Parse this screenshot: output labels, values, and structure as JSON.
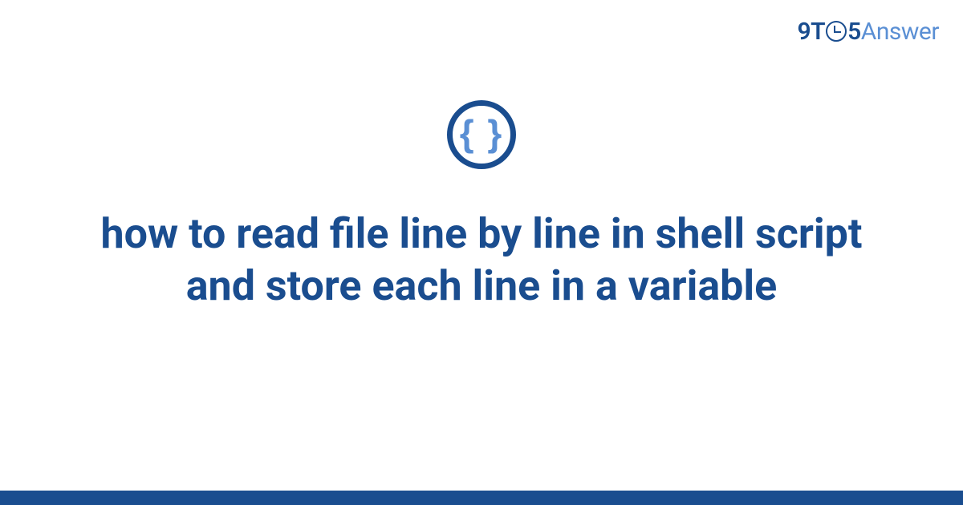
{
  "logo": {
    "part1": "9T",
    "part2": "5",
    "part3": "Answer"
  },
  "icon": {
    "symbol": "{ }",
    "name": "code-braces-icon"
  },
  "title": "how to read file line by line in shell script and store each line in a variable",
  "colors": {
    "primary": "#1a4d8f",
    "secondary": "#5a8fd4"
  }
}
